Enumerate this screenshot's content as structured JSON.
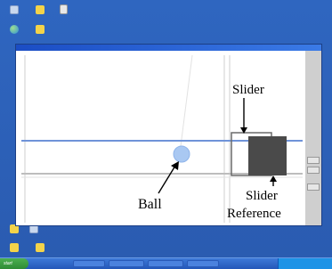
{
  "desktop": {
    "icons_top": [
      {
        "label": "",
        "icon": "recycle-bin-icon"
      },
      {
        "label": "",
        "icon": "folder-icon"
      },
      {
        "label": "",
        "icon": "document-icon"
      },
      {
        "label": "",
        "icon": "network-icon"
      },
      {
        "label": "",
        "icon": "folder-icon"
      }
    ],
    "icons_bottom": [
      {
        "label": "",
        "icon": "folder-icon"
      },
      {
        "label": "",
        "icon": "computer-icon"
      },
      {
        "label": "",
        "icon": "folder-icon"
      },
      {
        "label": "",
        "icon": "folder-icon"
      }
    ]
  },
  "window": {
    "title": "",
    "side_buttons": [
      "",
      "",
      ""
    ]
  },
  "annotations": {
    "slider": "Slider",
    "ball": "Ball",
    "slider_reference_line1": "Slider",
    "slider_reference_line2": "Reference"
  },
  "taskbar": {
    "start_label": "start",
    "tasks": [
      "",
      "",
      "",
      ""
    ],
    "clock": ""
  },
  "colors": {
    "desktop": "#2e63b8",
    "ball": "#a9c8f2",
    "track_line": "#6f93d8",
    "slider_block": "#4a4a4a"
  }
}
